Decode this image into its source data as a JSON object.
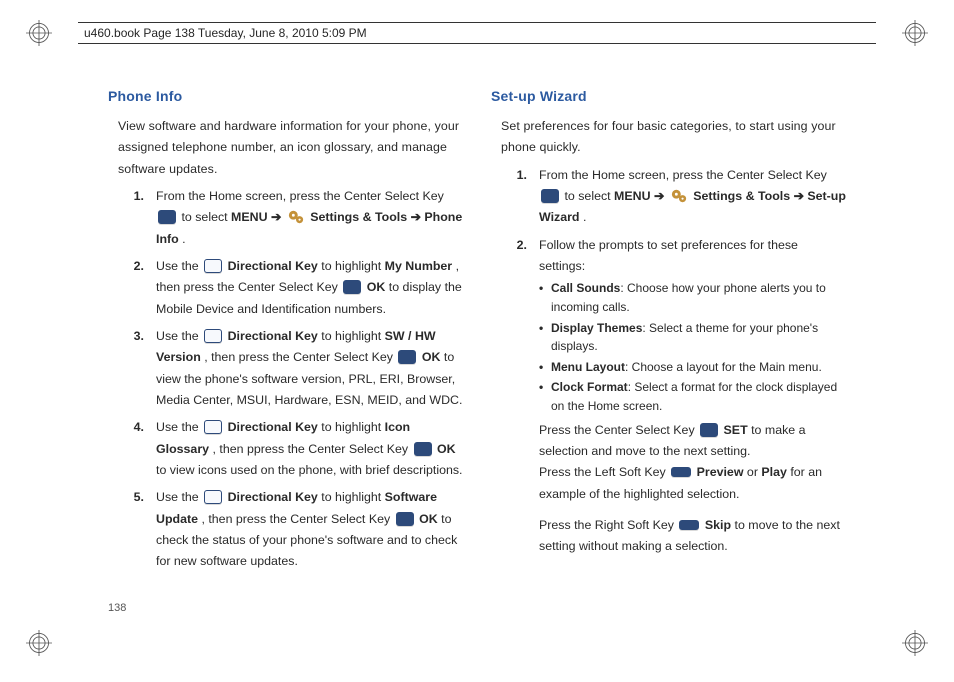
{
  "header": {
    "text": "u460.book  Page 138  Tuesday, June 8, 2010  5:09 PM"
  },
  "page_number": "138",
  "left": {
    "heading": "Phone Info",
    "intro": "View software and hardware information for your phone, your assigned telephone number, an icon glossary, and manage software updates.",
    "items": [
      {
        "n": "1.",
        "pre": "From the Home screen, press the Center Select Key ",
        "trail_a": " to select ",
        "b1": "MENU",
        "arrow1": " ➔ ",
        "b2": "Settings & Tools",
        "arrow2": "  ➔ ",
        "b3": "Phone Info",
        "end": "."
      },
      {
        "n": "2.",
        "pre": "Use the ",
        "b1": "Directional Key",
        "mid1": " to highlight ",
        "b2": "My Number",
        "mid2": ", then press the Center Select Key ",
        "b3": "OK",
        "mid3": "  to display the Mobile Device and Identification numbers."
      },
      {
        "n": "3.",
        "pre": "Use the ",
        "b1": "Directional Key",
        "mid1": " to highlight ",
        "b2": "SW / HW Version",
        "mid2": ", then press the Center Select Key ",
        "b3": "OK",
        "mid3": " to view the phone's software version, PRL, ERI, Browser, Media Center, MSUI, Hardware, ESN, MEID, and WDC."
      },
      {
        "n": "4.",
        "pre": "Use the ",
        "b1": "Directional Key",
        "mid1": " to highlight ",
        "b2": "Icon Glossary",
        "mid2": ", then ppress the Center Select Key ",
        "b3": "OK",
        "mid3": "  to view icons used on the phone, with  brief descriptions."
      },
      {
        "n": "5.",
        "pre": "Use the ",
        "b1": "Directional Key",
        "mid1": " to highlight ",
        "b2": "Software Update",
        "mid2": ", then press the Center Select Key ",
        "b3": "OK",
        "mid3": " to check the status of your phone's software and to check for new software updates."
      }
    ]
  },
  "right": {
    "heading": "Set-up Wizard",
    "intro": "Set preferences for four basic categories, to start using your phone quickly.",
    "item1": {
      "n": "1.",
      "pre": "From the Home screen, press the Center Select Key ",
      "trail_a": " to select ",
      "b1": "MENU",
      "arrow1": " ➔ ",
      "b2": "Settings & Tools",
      "arrow2": "  ➔ ",
      "b3": "Set-up Wizard",
      "end": "."
    },
    "item2": {
      "n": "2.",
      "lead": "Follow the prompts to set preferences for these settings:",
      "bullets": [
        {
          "b": "Call Sounds",
          "t": ": Choose how your phone alerts you to incoming calls."
        },
        {
          "b": "Display Themes",
          "t": ": Select a theme for your phone's displays."
        },
        {
          "b": "Menu Layout",
          "t": ": Choose a layout for the Main menu."
        },
        {
          "b": "Clock Format",
          "t": ": Select a format for the clock displayed on the Home screen."
        }
      ],
      "p1_a": "Press the Center Select Key ",
      "p1_b": "SET",
      "p1_c": " to make a selection and move to the next setting.",
      "p2_a": "Press the Left Soft Key ",
      "p2_b": "Preview",
      "p2_c": " or ",
      "p2_d": "Play",
      "p2_e": " for an example of the highlighted selection.",
      "p3_a": "Press the Right Soft Key ",
      "p3_b": "Skip",
      "p3_c": " to move to the next setting without making a selection."
    }
  }
}
